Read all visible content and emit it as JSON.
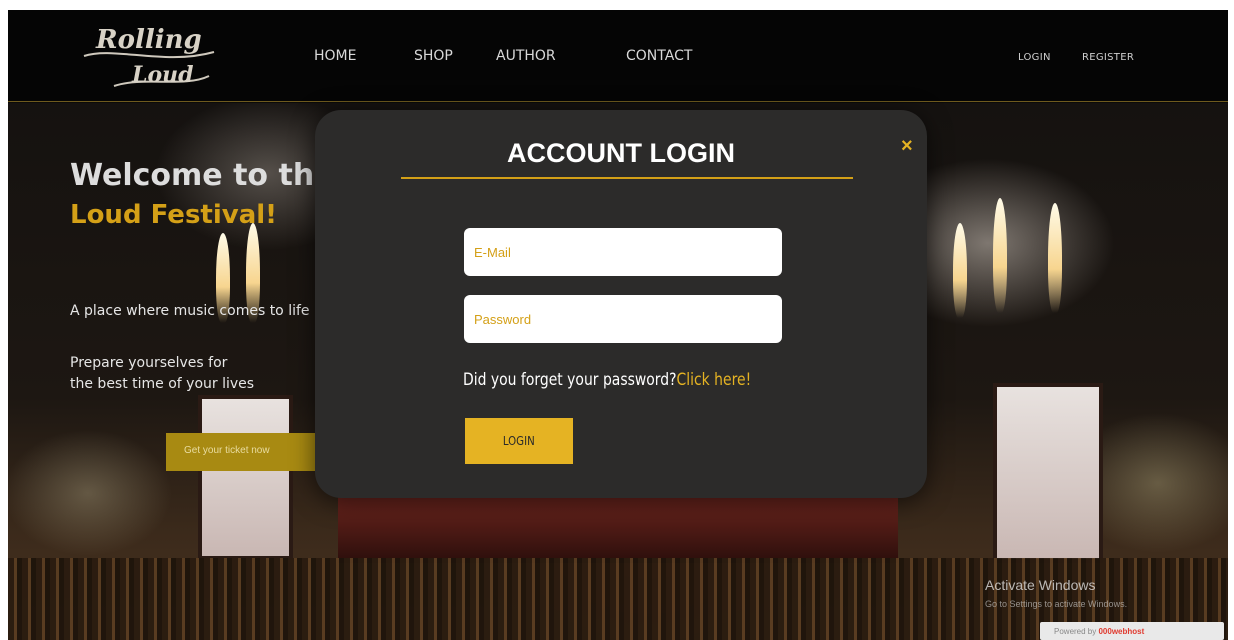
{
  "header": {
    "logo_text": "Rolling Loud",
    "nav": [
      {
        "label": "HOME",
        "active": true
      },
      {
        "label": "SHOP",
        "active": false
      },
      {
        "label": "AUTHOR",
        "active": false
      },
      {
        "label": "CONTACT",
        "active": false
      }
    ],
    "login_label": "LOGIN",
    "register_label": "REGISTER"
  },
  "hero": {
    "welcome": "Welcome to the Rolling",
    "festival": "Loud Festival!",
    "tagline_1": "A place where music comes to life",
    "tagline_2a": "Prepare yourselves for",
    "tagline_2b": "the best time of your lives",
    "ticket_button": "Get your ticket now"
  },
  "modal": {
    "title": "ACCOUNT LOGIN",
    "close_glyph": "×",
    "email_placeholder": "E-Mail",
    "password_placeholder": "Password",
    "forgot_text": "Did you forget your password?",
    "forgot_link": "Click here!",
    "login_button": "LOGIN"
  },
  "overlay": {
    "activate_title": "Activate Windows",
    "activate_sub": "Go to Settings to activate Windows.",
    "powered_prefix": "Powered by",
    "powered_brand": "000webhost"
  },
  "colors": {
    "accent": "#e5b323",
    "modal_bg": "#2c2b2a",
    "header_bg": "#050505"
  }
}
